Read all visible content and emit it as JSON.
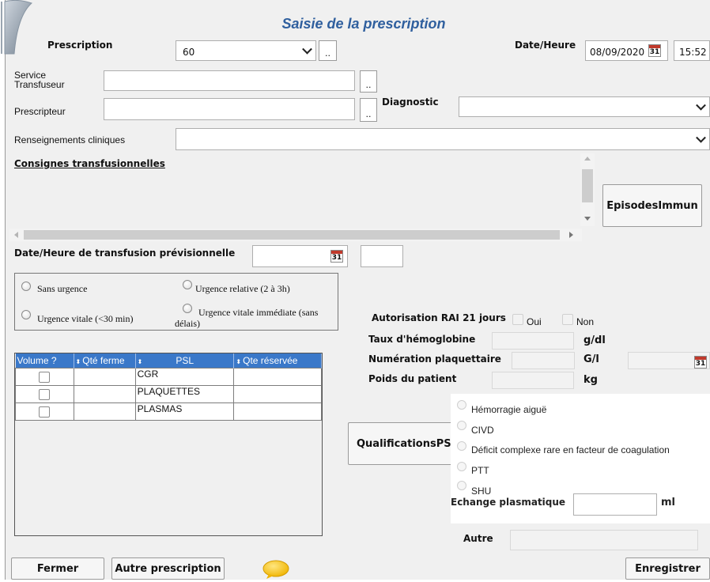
{
  "title": "Saisie de la prescription",
  "prescription": {
    "label": "Prescription",
    "value": "60",
    "more": ".."
  },
  "datetime": {
    "label": "Date/Heure",
    "date": "08/09/2020",
    "time": "15:52",
    "cal_day": "31"
  },
  "service": {
    "label": "Service Transfuseur",
    "value": "",
    "more": ".."
  },
  "prescripteur": {
    "label": "Prescripteur",
    "value": "",
    "more": ".."
  },
  "diagnostic": {
    "label": "Diagnostic",
    "value": ""
  },
  "renseignements": {
    "label": "Renseignements cliniques",
    "value": ""
  },
  "consignes": {
    "label": "Consignes transfusionnelles",
    "value": ""
  },
  "episodes_button": "EpisodesImmun",
  "transfusion": {
    "label": "Date/Heure de transfusion prévisionnelle",
    "date": "",
    "time": ""
  },
  "urgency": {
    "options": [
      "Sans urgence",
      "Urgence relative (2 à 3h)",
      "Urgence vitale (<30 min)",
      "Urgence vitale immédiate (sans délais)"
    ]
  },
  "rai": {
    "label": "Autorisation RAI 21 jours",
    "oui": "Oui",
    "non": "Non"
  },
  "hemoglobine": {
    "label": "Taux d'hémoglobine",
    "unit": "g/dl",
    "value": ""
  },
  "plaquettes": {
    "label": "Numération plaquettaire",
    "unit": "G/l",
    "value": "",
    "date": ""
  },
  "poids": {
    "label": "Poids du patient",
    "unit": "kg",
    "value": ""
  },
  "table": {
    "headers": [
      "Volume ?",
      "Qté ferme",
      "PSL",
      "Qte réservée"
    ],
    "rows": [
      {
        "psl": "CGR"
      },
      {
        "psl": "PLAQUETTES"
      },
      {
        "psl": "PLASMAS"
      }
    ]
  },
  "qualif_button": "QualificationsPS",
  "qualifications": [
    "Hémorragie aiguë",
    "CIVD",
    "Déficit complexe rare en facteur de coagulation",
    "PTT",
    "SHU"
  ],
  "echange": {
    "label": "Echange plasmatique",
    "unit": "ml",
    "value": ""
  },
  "autre": {
    "label": "Autre",
    "value": ""
  },
  "buttons": {
    "close": "Fermer",
    "other": "Autre prescription",
    "save": "Enregistrer"
  },
  "colors": {
    "title": "#2f5f9e",
    "table_header": "#3a78c9",
    "bubble": "#f5c518"
  }
}
